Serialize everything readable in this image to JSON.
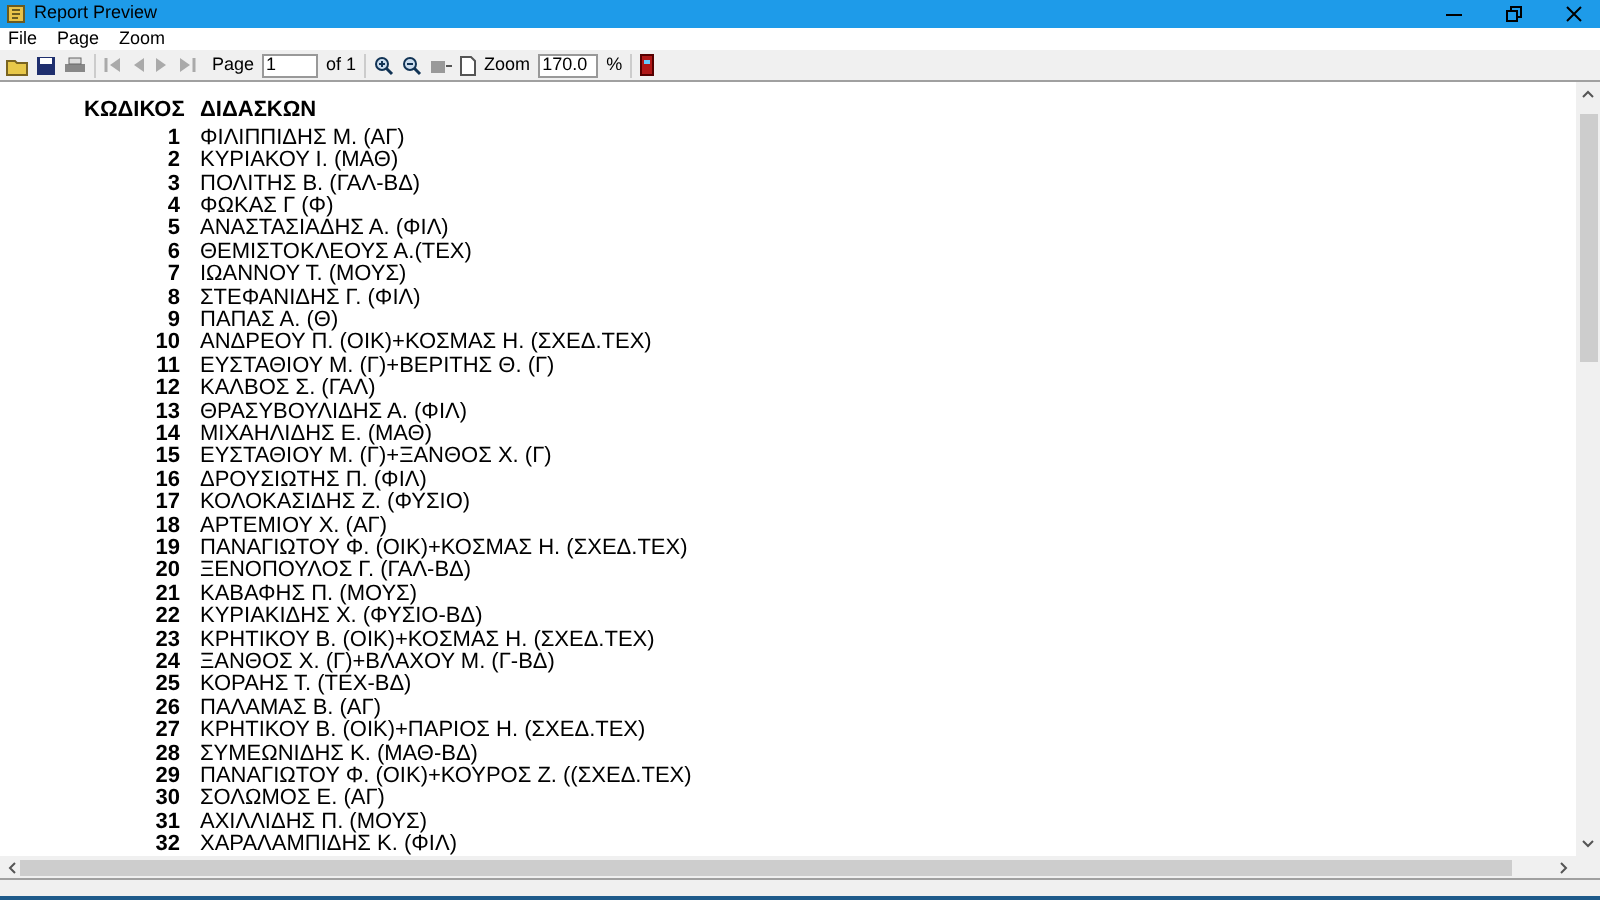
{
  "window": {
    "title": "Report Preview"
  },
  "menu": [
    "File",
    "Page",
    "Zoom"
  ],
  "toolbar": {
    "page_label": "Page",
    "page_value": "1",
    "of_label": "of 1",
    "zoom_label": "Zoom",
    "zoom_value": "170.0",
    "percent": "%"
  },
  "report": {
    "columns": [
      "ΚΩΔΙΚΟΣ",
      "ΔΙΔΑΣΚΩΝ"
    ],
    "rows": [
      {
        "code": "1",
        "name": "ΦΙΛΙΠΠΙΔΗΣ Μ. (ΑΓ)"
      },
      {
        "code": "2",
        "name": "ΚΥΡΙΑΚΟΥ Ι. (ΜΑΘ)"
      },
      {
        "code": "3",
        "name": "ΠΟΛΙΤΗΣ Β. (ΓΑΛ-ΒΔ)"
      },
      {
        "code": "4",
        "name": "ΦΩΚΑΣ Γ (Φ)"
      },
      {
        "code": "5",
        "name": "ΑΝΑΣΤΑΣΙΑΔΗΣ Α. (ΦΙΛ)"
      },
      {
        "code": "6",
        "name": "ΘΕΜΙΣΤΟΚΛΕΟΥΣ Α.(ΤΕΧ)"
      },
      {
        "code": "7",
        "name": "ΙΩΑΝΝΟΥ Τ. (ΜΟΥΣ)"
      },
      {
        "code": "8",
        "name": "ΣΤΕΦΑΝΙΔΗΣ Γ. (ΦΙΛ)"
      },
      {
        "code": "9",
        "name": "ΠΑΠΑΣ Α. (Θ)"
      },
      {
        "code": "10",
        "name": "ΑΝΔΡΕΟΥ Π. (ΟΙΚ)+ΚΟΣΜΑΣ Η. (ΣΧΕΔ.ΤΕΧ)"
      },
      {
        "code": "11",
        "name": "ΕΥΣΤΑΘΙΟΥ Μ. (Γ)+ΒΕΡΙΤΗΣ Θ. (Γ)"
      },
      {
        "code": "12",
        "name": "ΚΑΛΒΟΣ Σ. (ΓΑΛ)"
      },
      {
        "code": "13",
        "name": "ΘΡΑΣΥΒΟΥΛΙΔΗΣ Α. (ΦΙΛ)"
      },
      {
        "code": "14",
        "name": "ΜΙΧΑΗΛΙΔΗΣ Ε. (ΜΑΘ)"
      },
      {
        "code": "15",
        "name": "ΕΥΣΤΑΘΙΟΥ Μ. (Γ)+ΞΑΝΘΟΣ Χ. (Γ)"
      },
      {
        "code": "16",
        "name": "ΔΡΟΥΣΙΩΤΗΣ Π. (ΦΙΛ)"
      },
      {
        "code": "17",
        "name": "ΚΟΛΟΚΑΣΙΔΗΣ Ζ. (ΦΥΣΙΟ)"
      },
      {
        "code": "18",
        "name": "ΑΡΤΕΜΙΟΥ Χ. (ΑΓ)"
      },
      {
        "code": "19",
        "name": "ΠΑΝΑΓΙΩΤΟΥ Φ. (ΟΙΚ)+ΚΟΣΜΑΣ Η. (ΣΧΕΔ.ΤΕΧ)"
      },
      {
        "code": "20",
        "name": "ΞΕΝΟΠΟΥΛΟΣ Γ. (ΓΑΛ-ΒΔ)"
      },
      {
        "code": "21",
        "name": "ΚΑΒΑΦΗΣ Π. (ΜΟΥΣ)"
      },
      {
        "code": "22",
        "name": "ΚΥΡΙΑΚΙΔΗΣ Χ. (ΦΥΣΙΟ-ΒΔ)"
      },
      {
        "code": "23",
        "name": "ΚΡΗΤΙΚΟΥ Β. (ΟΙΚ)+ΚΟΣΜΑΣ Η. (ΣΧΕΔ.ΤΕΧ)"
      },
      {
        "code": "24",
        "name": "ΞΑΝΘΟΣ Χ. (Γ)+ΒΛΑΧΟΥ Μ. (Γ-ΒΔ)"
      },
      {
        "code": "25",
        "name": "ΚΟΡΑΗΣ Τ. (ΤΕΧ-ΒΔ)"
      },
      {
        "code": "26",
        "name": "ΠΑΛΑΜΑΣ Β. (ΑΓ)"
      },
      {
        "code": "27",
        "name": "ΚΡΗΤΙΚΟΥ Β. (ΟΙΚ)+ΠΑΡΙΟΣ Η. (ΣΧΕΔ.ΤΕΧ)"
      },
      {
        "code": "28",
        "name": "ΣΥΜΕΩΝΙΔΗΣ Κ. (ΜΑΘ-ΒΔ)"
      },
      {
        "code": "29",
        "name": "ΠΑΝΑΓΙΩΤΟΥ Φ. (ΟΙΚ)+ΚΟΥΡΟΣ Ζ. ((ΣΧΕΔ.ΤΕΧ)"
      },
      {
        "code": "30",
        "name": "ΣΟΛΩΜΟΣ Ε. (ΑΓ)"
      },
      {
        "code": "31",
        "name": "ΑΧΙΛΛΙΔΗΣ Π. (ΜΟΥΣ)"
      },
      {
        "code": "32",
        "name": "ΧΑΡΑΛΑΜΠΙΔΗΣ Κ. (ΦΙΛ)"
      }
    ]
  }
}
